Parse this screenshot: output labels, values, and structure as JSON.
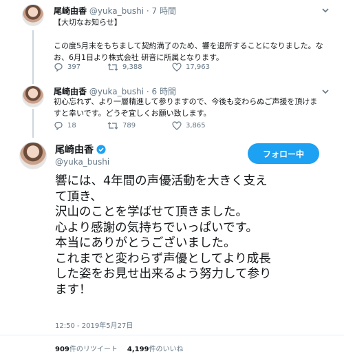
{
  "tweets": [
    {
      "name": "尾崎由香",
      "handle": "@yuka_bushi",
      "separator": "·",
      "time": "7 時間",
      "lines": [
        "【大切なお知らせ】",
        "",
        "この度5月末をもちまして契約満了のため、響を退所することになりました。な",
        "お、6月1日より株式会社 研音に所属となります。"
      ],
      "replies": "397",
      "retweets": "9,388",
      "likes": "17,963"
    },
    {
      "name": "尾崎由香",
      "handle": "@yuka_bushi",
      "separator": "·",
      "time": "6 時間",
      "lines": [
        "初心忘れず、より一層精進して参りますので、今後も変わらぬご声援を頂けま",
        "すと幸いです。どうぞ宜しくお願い致します。"
      ],
      "replies": "18",
      "retweets": "789",
      "likes": "3,865"
    }
  ],
  "main": {
    "name": "尾崎由香",
    "handle": "@yuka_bushi",
    "follow_label": "フォロー中",
    "lines": [
      "響には、4年間の声優活動を大きく支え",
      "て頂き、",
      "沢山のことを学ばせて頂きました。",
      "心より感謝の気持ちでいっぱいです。",
      "本当にありがとうございました。",
      "これまでと変わらず声優としてより成長",
      "した姿をお見せ出来るよう努力して参り",
      "ます！"
    ],
    "datetime": "12:50 - 2019年5月27日",
    "retweet_count": "909",
    "retweet_label": "件のリツイート",
    "like_count": "4,199",
    "like_label": "件のいいね"
  },
  "colors": {
    "accent": "#1da1f2",
    "muted": "#657786",
    "text": "#14171a"
  }
}
